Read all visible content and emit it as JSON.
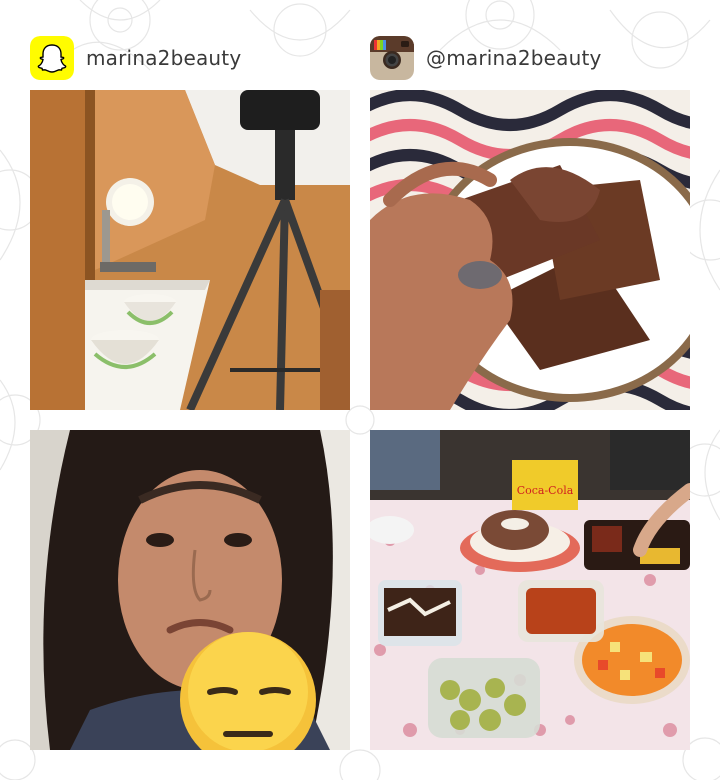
{
  "snapchat": {
    "handle": "marina2beauty",
    "icon": "snapchat-ghost-icon",
    "color": "#FFFC00"
  },
  "instagram": {
    "handle": "@marina2beauty",
    "icon": "instagram-camera-icon"
  },
  "photos": [
    {
      "subject": "studio-setup"
    },
    {
      "subject": "brownie"
    },
    {
      "subject": "selfie-with-emoji"
    },
    {
      "subject": "food-table"
    }
  ],
  "crate_text": "Coca-Cola"
}
